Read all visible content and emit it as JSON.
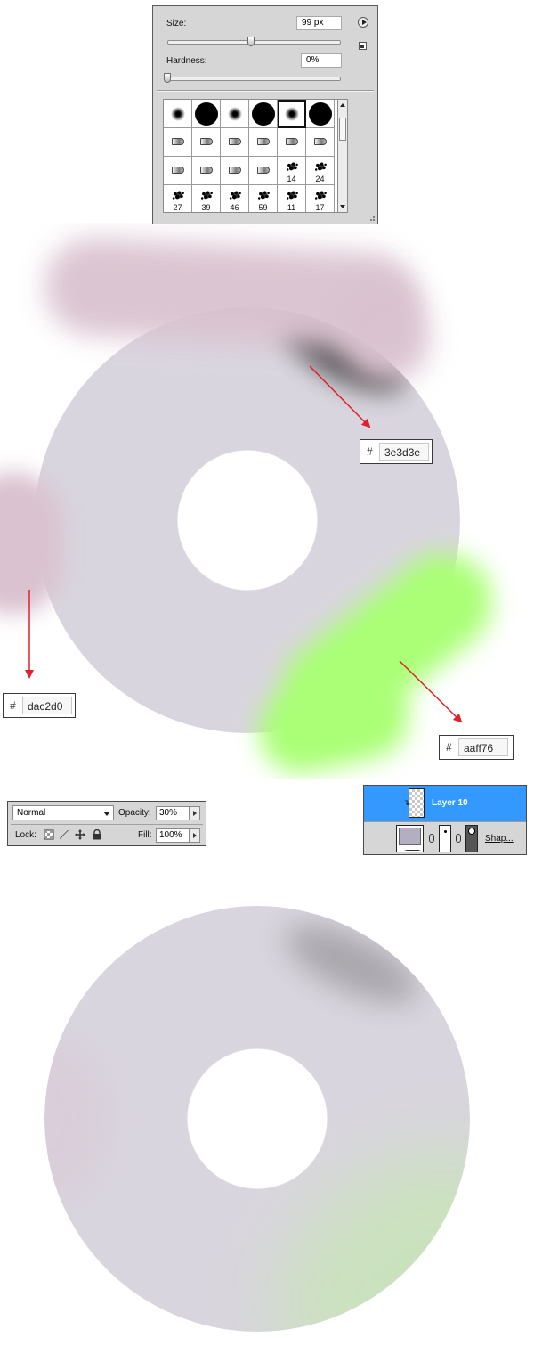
{
  "brush_panel": {
    "size_label": "Size:",
    "size_value": "99 px",
    "size_slider_value": 99,
    "hardness_label": "Hardness:",
    "hardness_value": "0%",
    "hardness_slider_fraction": 0.0,
    "selected_preset_index": 4,
    "presets": [
      {
        "type": "soft-round",
        "size": ""
      },
      {
        "type": "hard-round",
        "size": ""
      },
      {
        "type": "soft-round",
        "size": ""
      },
      {
        "type": "hard-round",
        "size": ""
      },
      {
        "type": "soft-round",
        "size": ""
      },
      {
        "type": "hard-round",
        "size": ""
      },
      {
        "type": "tool-tip",
        "size": ""
      },
      {
        "type": "tool-tip",
        "size": ""
      },
      {
        "type": "tool-tip",
        "size": ""
      },
      {
        "type": "tool-tip",
        "size": ""
      },
      {
        "type": "tool-tip",
        "size": ""
      },
      {
        "type": "tool-tip",
        "size": ""
      },
      {
        "type": "tool-tip",
        "size": ""
      },
      {
        "type": "tool-tip",
        "size": ""
      },
      {
        "type": "tool-tip",
        "size": ""
      },
      {
        "type": "tool-tip",
        "size": ""
      },
      {
        "type": "scatter",
        "size": "14"
      },
      {
        "type": "scatter",
        "size": "24"
      },
      {
        "type": "scatter",
        "size": "27"
      },
      {
        "type": "scatter",
        "size": "39"
      },
      {
        "type": "scatter",
        "size": "46"
      },
      {
        "type": "scatter",
        "size": "59"
      },
      {
        "type": "scatter",
        "size": "11"
      },
      {
        "type": "scatter",
        "size": "17"
      }
    ],
    "icons": {
      "menu": "flyout-menu-icon",
      "new_preset": "new-preset-icon",
      "resize": "resize-grip-icon"
    }
  },
  "swatches": {
    "dark": {
      "hash": "#",
      "hex": "3e3d3e",
      "color": "#3e3d3e"
    },
    "pink": {
      "hash": "#",
      "hex": "dac2d0",
      "color": "#dac2d0"
    },
    "green": {
      "hash": "#",
      "hex": "aaff76",
      "color": "#aaff76"
    }
  },
  "colors": {
    "donut_fill": "#d9d5de",
    "annotation_arrow": "#e0202a",
    "layer_highlight": "#3399ff"
  },
  "layer_options": {
    "blend_mode": "Normal",
    "opacity_label": "Opacity:",
    "opacity_value": "30%",
    "lock_label": "Lock:",
    "lock_icons": [
      "lock-transparent-pixels-icon",
      "lock-image-pixels-icon",
      "lock-position-icon",
      "lock-all-icon"
    ],
    "fill_label": "Fill:",
    "fill_value": "100%"
  },
  "layers_panel": {
    "active_layer_name": "Layer 10",
    "shape_layer_name": "Shap..."
  }
}
